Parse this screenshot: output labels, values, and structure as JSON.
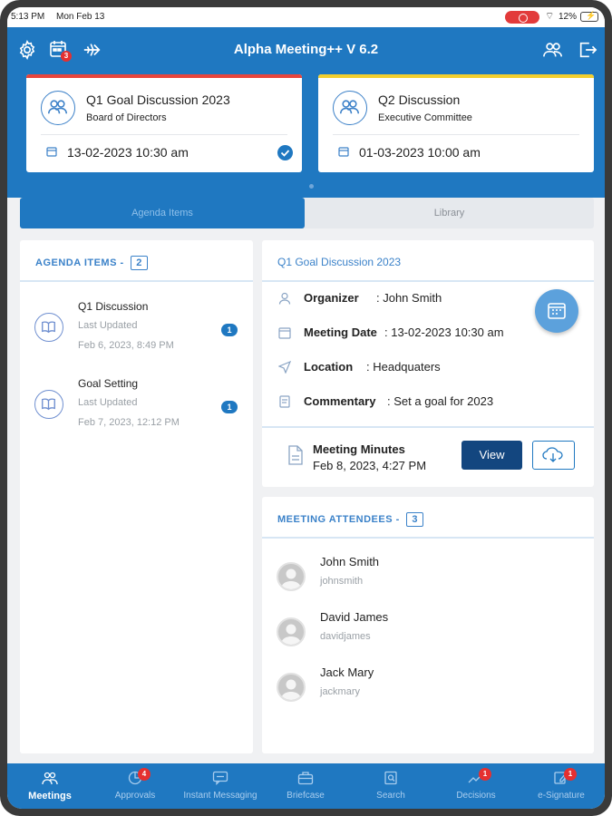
{
  "status_bar": {
    "time": "5:13 PM",
    "date": "Mon Feb 13",
    "battery": "12%"
  },
  "header": {
    "title": "Alpha Meeting++ V 6.2",
    "calendar_badge": "3",
    "meetings": [
      {
        "title": "Q1 Goal Discussion 2023",
        "subtitle": "Board of Directors",
        "datetime": "13-02-2023 10:30 am",
        "accent": "#e8453c"
      },
      {
        "title": "Q2 Discussion",
        "subtitle": "Executive Committee",
        "datetime": "01-03-2023 10:00 am",
        "accent": "#f3cf2e"
      }
    ]
  },
  "segments": {
    "agenda": "Agenda Items",
    "library": "Library"
  },
  "agenda": {
    "heading": "AGENDA ITEMS -",
    "count": "2",
    "items": [
      {
        "name": "Q1 Discussion",
        "last_updated_label": "Last Updated",
        "date": "Feb 6, 2023, 8:49 PM",
        "badge": "1"
      },
      {
        "name": "Goal Setting",
        "last_updated_label": "Last Updated",
        "date": "Feb 7, 2023, 12:12 PM",
        "badge": "1"
      }
    ]
  },
  "details": {
    "heading": "Q1 Goal Discussion 2023",
    "organizer_label": "Organizer",
    "organizer": ": John Smith",
    "date_label": "Meeting Date",
    "date": ":  13-02-2023 10:30 am",
    "location_label": "Location",
    "location": ": Headquaters",
    "commentary_label": "Commentary",
    "commentary": ": Set a goal for 2023",
    "minutes_title": "Meeting Minutes",
    "minutes_date": "Feb 8, 2023, 4:27 PM",
    "view_label": "View"
  },
  "attendees": {
    "heading": "MEETING ATTENDEES -",
    "count": "3",
    "list": [
      {
        "name": "John Smith",
        "username": "johnsmith"
      },
      {
        "name": "David James",
        "username": "davidjames"
      },
      {
        "name": "Jack Mary",
        "username": "jackmary"
      }
    ]
  },
  "tabs": [
    {
      "label": "Meetings",
      "icon": "people-icon",
      "badge": ""
    },
    {
      "label": "Approvals",
      "icon": "pie-icon",
      "badge": "4"
    },
    {
      "label": "Instant Messaging",
      "icon": "chat-icon",
      "badge": ""
    },
    {
      "label": "Briefcase",
      "icon": "briefcase-icon",
      "badge": ""
    },
    {
      "label": "Search",
      "icon": "search-icon",
      "badge": ""
    },
    {
      "label": "Decisions",
      "icon": "trend-icon",
      "badge": "1"
    },
    {
      "label": "e-Signature",
      "icon": "signature-icon",
      "badge": "1"
    }
  ],
  "colors": {
    "primary": "#1f78c1",
    "dark_button": "#13467f",
    "badge_red": "#e53030"
  }
}
